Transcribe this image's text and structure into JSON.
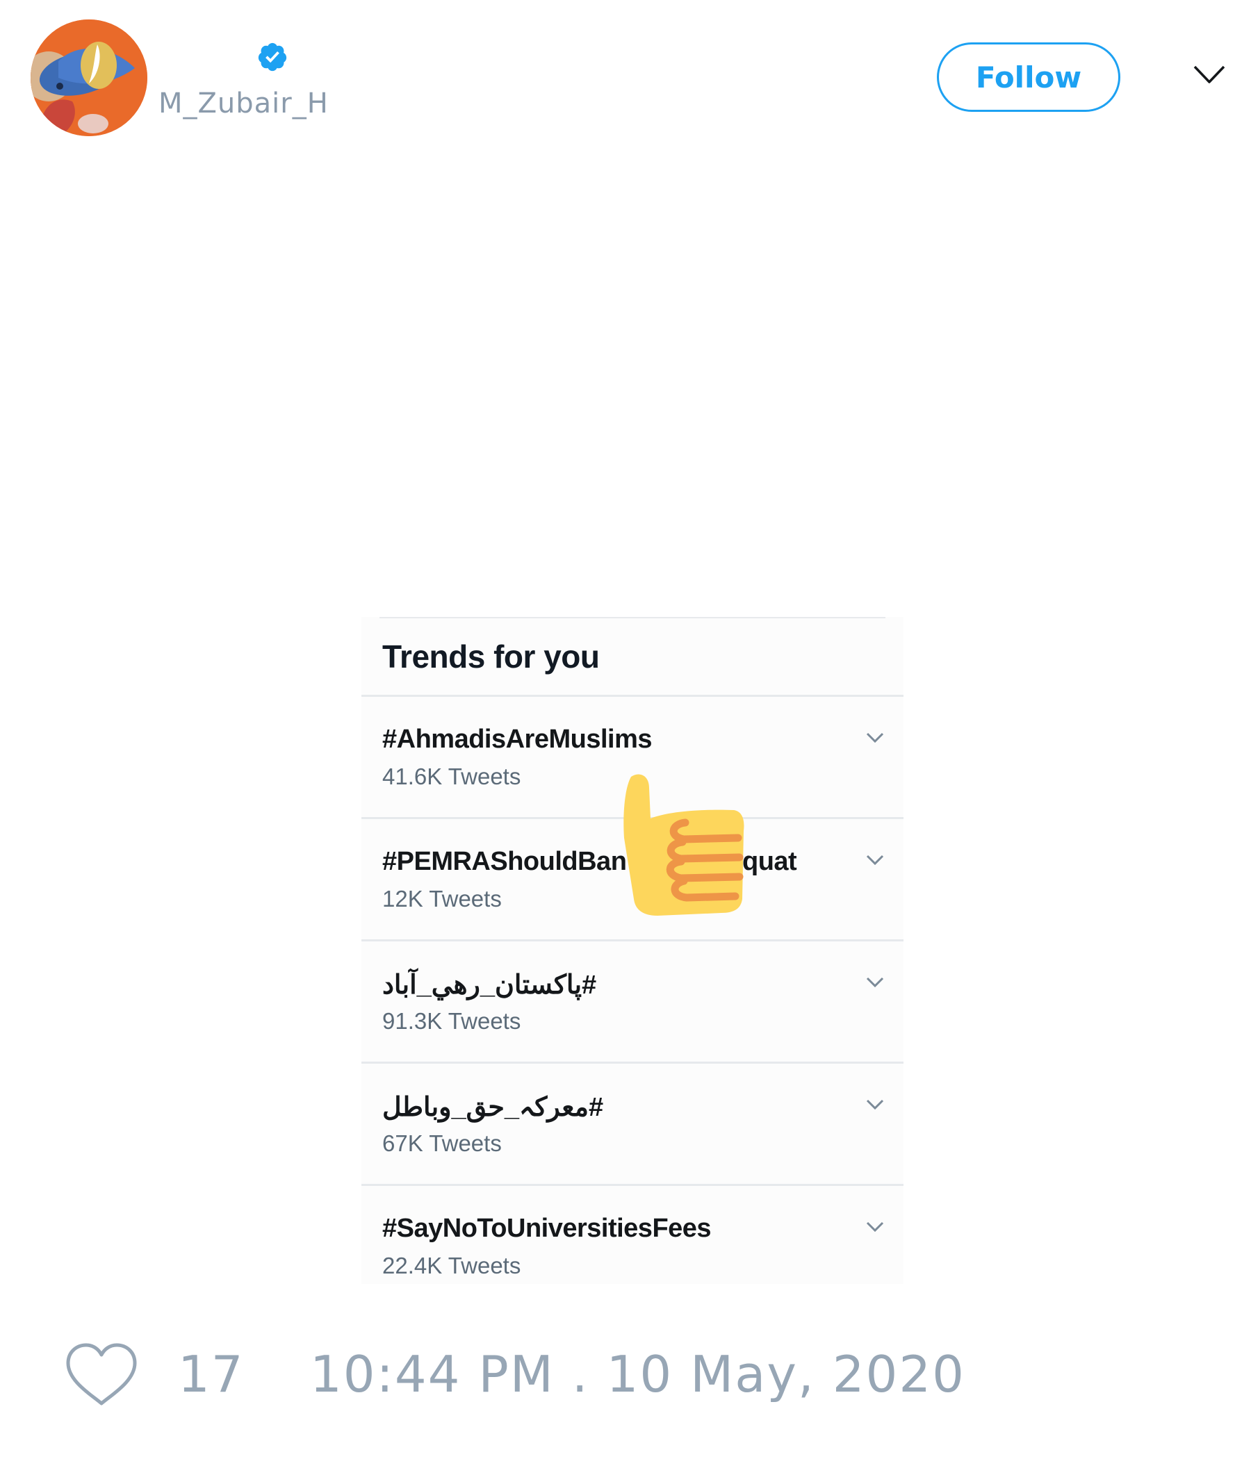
{
  "tweet": {
    "author": {
      "username": "M_Zubair_H",
      "verified": true,
      "avatar_icon": "avatar-image"
    },
    "follow_label": "Follow",
    "menu_icon": "chevron-down-icon",
    "likes": "17",
    "timestamp": "10:44 PM . 10 May, 2020"
  },
  "trends_panel": {
    "title": "Trends for you",
    "items": [
      {
        "name": "#AhmadisAreMuslims",
        "count": "41.6K Tweets"
      },
      {
        "name": "#PEMRAShouldBan",
        "name_tail": "quat",
        "count": "12K Tweets"
      },
      {
        "name": "#پاکستان_رھي_آباد",
        "count": "91.3K Tweets"
      },
      {
        "name": "#معرکہ_حق_وباطل",
        "count": "67K Tweets"
      },
      {
        "name": "#SayNoToUniversitiesFees",
        "count": "22.4K Tweets"
      }
    ]
  },
  "overlay": {
    "icon": "thumbs-up-emoji"
  },
  "colors": {
    "accent": "#1da1f2",
    "muted_text": "#97a6b5",
    "avatar_bg": "#e96a2a",
    "emoji_yellow": "#fdd65c"
  }
}
